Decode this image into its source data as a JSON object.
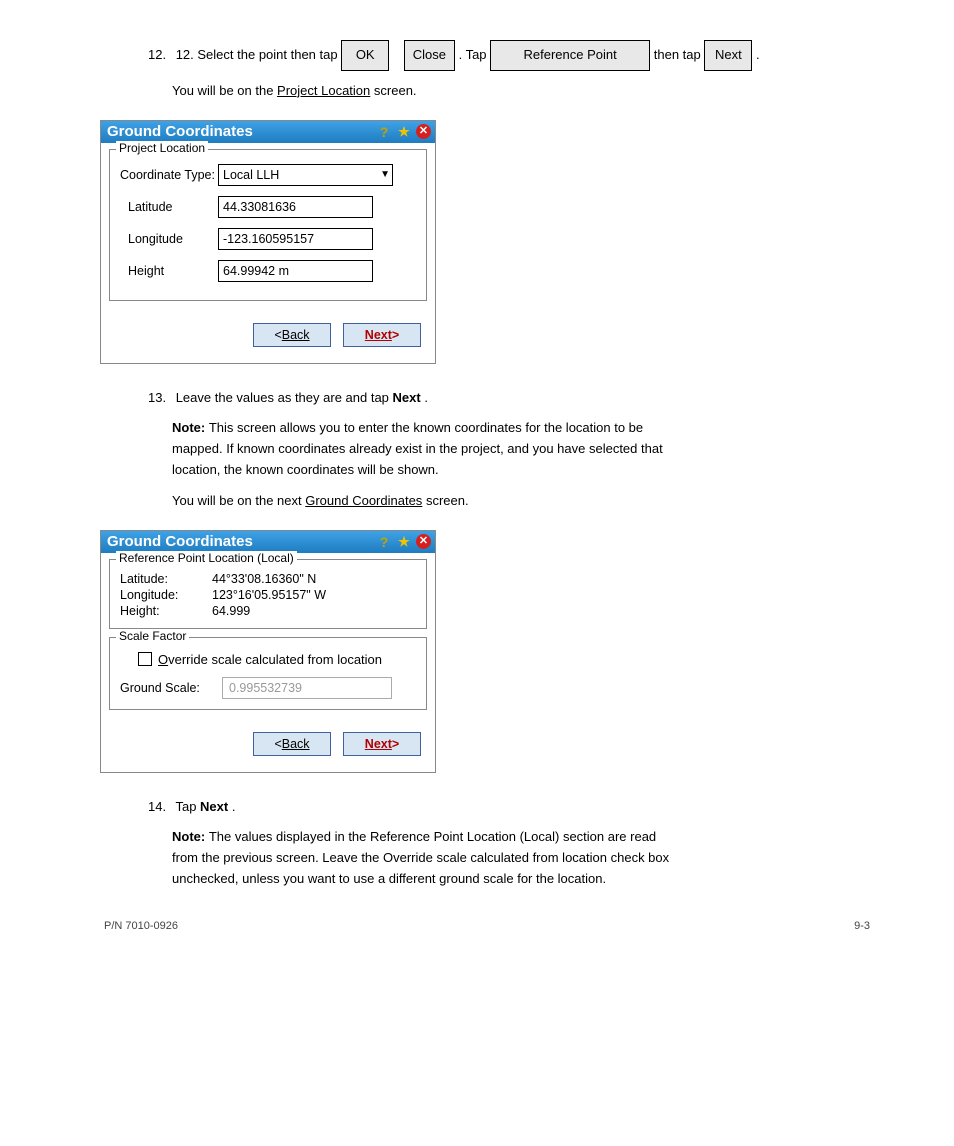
{
  "intro1_pre": "12. Select the point then tap ",
  "intro1_btns": [
    "OK",
    "Close"
  ],
  "intro1_mid": ". Tap ",
  "intro1_btn3": "Reference Point",
  "intro1_mid2": " then tap ",
  "intro1_btn4": "Next",
  "intro1_post": ".",
  "intro2_line": "You will be on the ",
  "intro2_link": "Project Location",
  "intro2_post": " screen.",
  "dlg1": {
    "title": "Ground Coordinates",
    "group": "Project Location",
    "coord_label": "Coordinate Type:",
    "coord_value": "Local LLH",
    "lat_label": "Latitude",
    "lat_value": "44.33081636",
    "lon_label": "Longitude",
    "lon_value": "-123.160595157",
    "ht_label": "Height",
    "ht_value": "64.99942 m",
    "back": "Back",
    "next": "Next"
  },
  "step13_pre": "Leave the values as they are and tap ",
  "step13_btn": "Next",
  "step13_post": ".",
  "noteA1_pre": "Note: ",
  "noteA1": "This screen allows you to enter the known coordinates for the location to be",
  "noteA2": "mapped. If known coordinates already exist in the project, and you have selected that",
  "noteA3": "location, the known coordinates will be shown.",
  "line14a": "You will be on the next ",
  "line14a_link": "Ground Coordinates",
  "line14a_post": " screen.",
  "dlg2": {
    "title": "Ground Coordinates",
    "group1": "Reference Point Location (Local)",
    "lat_label": "Latitude:",
    "lat_val": "44°33'08.16360\" N",
    "lon_label": "Longitude:",
    "lon_val": "123°16'05.95157\" W",
    "ht_label": "Height:",
    "ht_val": "64.999",
    "group2": "Scale Factor",
    "chk_label": "Override scale calculated from location",
    "gs_label": "Ground Scale:",
    "gs_val": "0.995532739",
    "back": "Back",
    "next": "Next"
  },
  "step14_pre": "Tap ",
  "step14_btn": "Next",
  "step14_post": ".",
  "noteB1_pre": "Note: ",
  "noteB1": "The values displayed in the Reference Point Location (Local) section are read",
  "noteB2": "from the previous screen. Leave the Override scale calculated from location check box",
  "noteB3": "unchecked, unless you want to use a different ground scale for the location.",
  "footer_left": "P/N 7010-0926",
  "footer_right": "9-3"
}
